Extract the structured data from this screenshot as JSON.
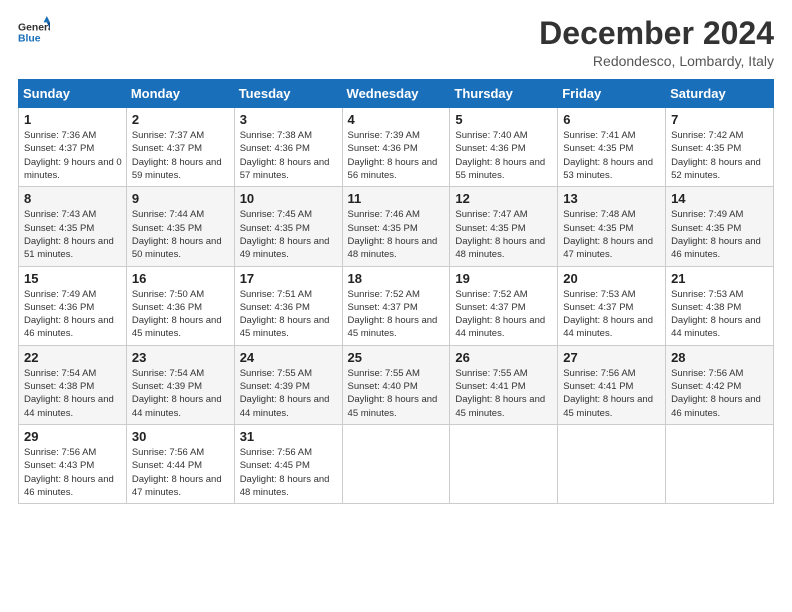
{
  "logo": {
    "text_general": "General",
    "text_blue": "Blue"
  },
  "title": "December 2024",
  "subtitle": "Redondesco, Lombardy, Italy",
  "days_header": [
    "Sunday",
    "Monday",
    "Tuesday",
    "Wednesday",
    "Thursday",
    "Friday",
    "Saturday"
  ],
  "weeks": [
    [
      {
        "day": "1",
        "sunrise": "7:36 AM",
        "sunset": "4:37 PM",
        "daylight": "9 hours and 0 minutes."
      },
      {
        "day": "2",
        "sunrise": "7:37 AM",
        "sunset": "4:37 PM",
        "daylight": "8 hours and 59 minutes."
      },
      {
        "day": "3",
        "sunrise": "7:38 AM",
        "sunset": "4:36 PM",
        "daylight": "8 hours and 57 minutes."
      },
      {
        "day": "4",
        "sunrise": "7:39 AM",
        "sunset": "4:36 PM",
        "daylight": "8 hours and 56 minutes."
      },
      {
        "day": "5",
        "sunrise": "7:40 AM",
        "sunset": "4:36 PM",
        "daylight": "8 hours and 55 minutes."
      },
      {
        "day": "6",
        "sunrise": "7:41 AM",
        "sunset": "4:35 PM",
        "daylight": "8 hours and 53 minutes."
      },
      {
        "day": "7",
        "sunrise": "7:42 AM",
        "sunset": "4:35 PM",
        "daylight": "8 hours and 52 minutes."
      }
    ],
    [
      {
        "day": "8",
        "sunrise": "7:43 AM",
        "sunset": "4:35 PM",
        "daylight": "8 hours and 51 minutes."
      },
      {
        "day": "9",
        "sunrise": "7:44 AM",
        "sunset": "4:35 PM",
        "daylight": "8 hours and 50 minutes."
      },
      {
        "day": "10",
        "sunrise": "7:45 AM",
        "sunset": "4:35 PM",
        "daylight": "8 hours and 49 minutes."
      },
      {
        "day": "11",
        "sunrise": "7:46 AM",
        "sunset": "4:35 PM",
        "daylight": "8 hours and 48 minutes."
      },
      {
        "day": "12",
        "sunrise": "7:47 AM",
        "sunset": "4:35 PM",
        "daylight": "8 hours and 48 minutes."
      },
      {
        "day": "13",
        "sunrise": "7:48 AM",
        "sunset": "4:35 PM",
        "daylight": "8 hours and 47 minutes."
      },
      {
        "day": "14",
        "sunrise": "7:49 AM",
        "sunset": "4:35 PM",
        "daylight": "8 hours and 46 minutes."
      }
    ],
    [
      {
        "day": "15",
        "sunrise": "7:49 AM",
        "sunset": "4:36 PM",
        "daylight": "8 hours and 46 minutes."
      },
      {
        "day": "16",
        "sunrise": "7:50 AM",
        "sunset": "4:36 PM",
        "daylight": "8 hours and 45 minutes."
      },
      {
        "day": "17",
        "sunrise": "7:51 AM",
        "sunset": "4:36 PM",
        "daylight": "8 hours and 45 minutes."
      },
      {
        "day": "18",
        "sunrise": "7:52 AM",
        "sunset": "4:37 PM",
        "daylight": "8 hours and 45 minutes."
      },
      {
        "day": "19",
        "sunrise": "7:52 AM",
        "sunset": "4:37 PM",
        "daylight": "8 hours and 44 minutes."
      },
      {
        "day": "20",
        "sunrise": "7:53 AM",
        "sunset": "4:37 PM",
        "daylight": "8 hours and 44 minutes."
      },
      {
        "day": "21",
        "sunrise": "7:53 AM",
        "sunset": "4:38 PM",
        "daylight": "8 hours and 44 minutes."
      }
    ],
    [
      {
        "day": "22",
        "sunrise": "7:54 AM",
        "sunset": "4:38 PM",
        "daylight": "8 hours and 44 minutes."
      },
      {
        "day": "23",
        "sunrise": "7:54 AM",
        "sunset": "4:39 PM",
        "daylight": "8 hours and 44 minutes."
      },
      {
        "day": "24",
        "sunrise": "7:55 AM",
        "sunset": "4:39 PM",
        "daylight": "8 hours and 44 minutes."
      },
      {
        "day": "25",
        "sunrise": "7:55 AM",
        "sunset": "4:40 PM",
        "daylight": "8 hours and 45 minutes."
      },
      {
        "day": "26",
        "sunrise": "7:55 AM",
        "sunset": "4:41 PM",
        "daylight": "8 hours and 45 minutes."
      },
      {
        "day": "27",
        "sunrise": "7:56 AM",
        "sunset": "4:41 PM",
        "daylight": "8 hours and 45 minutes."
      },
      {
        "day": "28",
        "sunrise": "7:56 AM",
        "sunset": "4:42 PM",
        "daylight": "8 hours and 46 minutes."
      }
    ],
    [
      {
        "day": "29",
        "sunrise": "7:56 AM",
        "sunset": "4:43 PM",
        "daylight": "8 hours and 46 minutes."
      },
      {
        "day": "30",
        "sunrise": "7:56 AM",
        "sunset": "4:44 PM",
        "daylight": "8 hours and 47 minutes."
      },
      {
        "day": "31",
        "sunrise": "7:56 AM",
        "sunset": "4:45 PM",
        "daylight": "8 hours and 48 minutes."
      },
      null,
      null,
      null,
      null
    ]
  ]
}
